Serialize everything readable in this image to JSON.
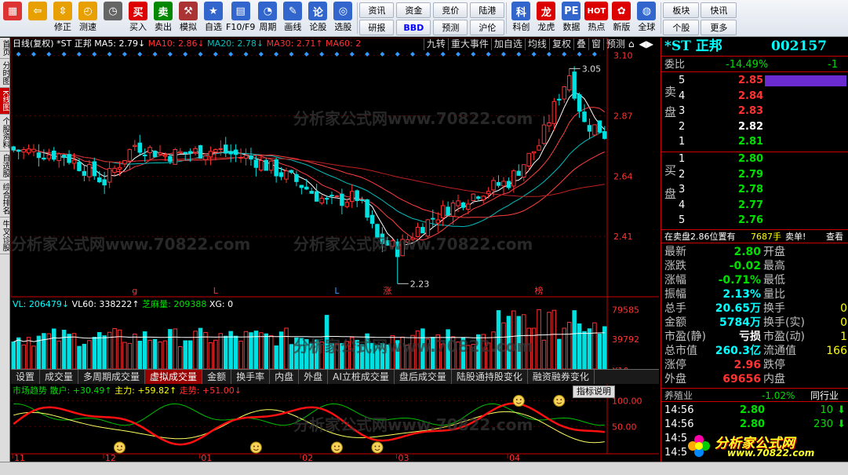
{
  "toolbar": {
    "buttons": [
      {
        "label": "",
        "icon": "grid-app-icon",
        "color": "#d33",
        "glyph": "▦"
      },
      {
        "label": "",
        "icon": "back-arrow-icon",
        "color": "#e8a000",
        "glyph": "⇦"
      },
      {
        "label": "修正",
        "icon": "up-down-arrows-icon",
        "color": "#e8a000",
        "glyph": "⇳"
      },
      {
        "label": "测速",
        "icon": "speed-test-clock-icon",
        "color": "#e8a000",
        "glyph": "◴"
      },
      {
        "label": "",
        "icon": "timer-clock-icon",
        "color": "#666",
        "glyph": "◷"
      },
      {
        "label": "买入",
        "icon": "buy-icon",
        "color": "#d00",
        "glyph": "买"
      },
      {
        "label": "卖出",
        "icon": "sell-icon",
        "color": "#080",
        "glyph": "卖"
      },
      {
        "label": "模拟",
        "icon": "hammer-icon",
        "color": "#a33",
        "glyph": "⚒"
      },
      {
        "label": "自选",
        "icon": "favorites-icon",
        "color": "#36c",
        "glyph": "★"
      },
      {
        "label": "F10/F9",
        "icon": "f10-screen-icon",
        "color": "#36c",
        "glyph": "▤"
      },
      {
        "label": "周期",
        "icon": "period-clock-icon",
        "color": "#36c",
        "glyph": "◔"
      },
      {
        "label": "画线",
        "icon": "pencil-icon",
        "color": "#36c",
        "glyph": "✎"
      },
      {
        "label": "论股",
        "icon": "forum-icon",
        "color": "#36c",
        "glyph": "论"
      },
      {
        "label": "选股",
        "icon": "stock-picker-icon",
        "color": "#36c",
        "glyph": "◎"
      }
    ],
    "grid": [
      "资讯",
      "资金",
      "竞价",
      "陆港",
      "研报",
      "BBD",
      "预测",
      "沪伦"
    ],
    "buttons2": [
      {
        "label": "科创",
        "icon": "kechuang-icon",
        "color": "#36c",
        "glyph": "科"
      },
      {
        "label": "龙虎",
        "icon": "dragon-tiger-icon",
        "color": "#d00",
        "glyph": "龙"
      },
      {
        "label": "数据",
        "icon": "pe-data-icon",
        "color": "#36c",
        "glyph": "PE"
      },
      {
        "label": "热点",
        "icon": "hot-spot-icon",
        "color": "#d00",
        "glyph": "HOT"
      },
      {
        "label": "新版",
        "icon": "new-version-icon",
        "color": "#d00",
        "glyph": "✿"
      },
      {
        "label": "全球",
        "icon": "globe-icon",
        "color": "#36c",
        "glyph": "◍"
      }
    ],
    "grid2": [
      "板块",
      "快讯",
      "个股",
      "更多"
    ]
  },
  "left_tabs": [
    "首页",
    "分时图",
    "K线图",
    "个股资料",
    "自选股",
    "综合排名",
    "牛叉诊股"
  ],
  "chart_header": {
    "title": "日线(复权)",
    "stock": "*ST 正邦",
    "ma5": "MA5: 2.79↓",
    "ma10": "MA10: 2.86↓",
    "ma20": "MA20: 2.78↓",
    "ma30": "MA30: 2.71↑",
    "ma60": "MA60: 2",
    "buttons": [
      "九转",
      "重大事件",
      "加自选",
      "均线",
      "复权",
      "叠",
      "窗",
      "预测"
    ],
    "buttons_right": [
      "⌂",
      "◀▶"
    ]
  },
  "price_axis": [
    "3.10",
    "2.87",
    "2.64",
    "2.41"
  ],
  "annotations": {
    "high": "3.05",
    "low": "2.23",
    "markers": [
      "g",
      "L",
      "L",
      "涨",
      "榜"
    ]
  },
  "vol_header": {
    "vl": "VL: 206479↓",
    "vl60": "VL60: 338222↑",
    "zhi": "芝麻量: 209388",
    "xg": "XG: 0"
  },
  "vol_axis": [
    "79585",
    "39792",
    "X10"
  ],
  "ind_tabs": [
    "设置",
    "成交量",
    "多周期成交量",
    "虚拟成交量",
    "金额",
    "换手率",
    "内盘",
    "外盘",
    "AI立桩成交量",
    "盘后成交量",
    "陆股通持股变化",
    "融资融券变化"
  ],
  "ind_header": {
    "name": "市场趋势",
    "sh": "散户: +30.49↑",
    "zl": "主力: +59.82↑",
    "zs": "走势: +51.00↓",
    "explain": "指标说明"
  },
  "ind_axis": [
    "100.00",
    "50.00"
  ],
  "time_axis": [
    "11",
    "12",
    "01",
    "02",
    "03",
    "04"
  ],
  "right": {
    "title": "*ST 正邦",
    "code": "002157",
    "weibi_label": "委比",
    "weibi_val": "-14.49%",
    "weibi_val2": "-1",
    "sell_label1": "卖",
    "sell_label2": "盘",
    "sell": [
      {
        "n": "5",
        "p": "2.85"
      },
      {
        "n": "4",
        "p": "2.84"
      },
      {
        "n": "3",
        "p": "2.83"
      },
      {
        "n": "2",
        "p": "2.82"
      },
      {
        "n": "1",
        "p": "2.81"
      }
    ],
    "buy_label1": "买",
    "buy_label2": "盘",
    "buy": [
      {
        "n": "1",
        "p": "2.80"
      },
      {
        "n": "2",
        "p": "2.79"
      },
      {
        "n": "3",
        "p": "2.78"
      },
      {
        "n": "4",
        "p": "2.77"
      },
      {
        "n": "5",
        "p": "2.76"
      }
    ],
    "tip": "在卖盘2.86位置有",
    "tip_qty": "7687手",
    "tip_action": "卖单!",
    "tip_link": "查看",
    "stats": [
      {
        "k": "最新",
        "v": "2.80",
        "k2": "开盘",
        "v2": ""
      },
      {
        "k": "涨跌",
        "v": "-0.02",
        "k2": "最高",
        "v2": ""
      },
      {
        "k": "涨幅",
        "v": "-0.71%",
        "k2": "最低",
        "v2": ""
      },
      {
        "k": "振幅",
        "v": "2.13%",
        "k2": "量比",
        "v2": ""
      },
      {
        "k": "总手",
        "v": "20.65万",
        "k2": "换手",
        "v2": "0"
      },
      {
        "k": "金额",
        "v": "5784万",
        "k2": "换手(实)",
        "v2": "0"
      },
      {
        "k": "市盈(静)",
        "v": "亏损",
        "k2": "市盈(动)",
        "v2": "1"
      },
      {
        "k": "总市值",
        "v": "260.3亿",
        "k2": "流通值",
        "v2": "166"
      },
      {
        "k": "涨停",
        "v": "2.96",
        "k2": "跌停",
        "v2": ""
      },
      {
        "k": "外盘",
        "v": "69656",
        "k2": "内盘",
        "v2": ""
      }
    ],
    "industry_label": "养殖业",
    "industry_val": "-1.02%",
    "industry_btn": "同行业",
    "ticks": [
      {
        "t": "14:56",
        "p": "2.80",
        "q": "10"
      },
      {
        "t": "14:56",
        "p": "2.80",
        "q": "230"
      },
      {
        "t": "14:5",
        "p": "",
        "q": ""
      },
      {
        "t": "14:5",
        "p": "",
        "q": ""
      }
    ]
  },
  "watermark": "分析家公式网www.70822.com",
  "logo": "分析家公式网",
  "logo_url": "www.70822.com",
  "colors": {
    "up": "#ff3232",
    "down": "#00e0e0",
    "ma5": "#ffffff",
    "ma10": "#ff4040",
    "ma20": "#00c0c0",
    "ma30": "#ff4040",
    "ma60": "#ff3030",
    "accent": "#cc0000"
  }
}
